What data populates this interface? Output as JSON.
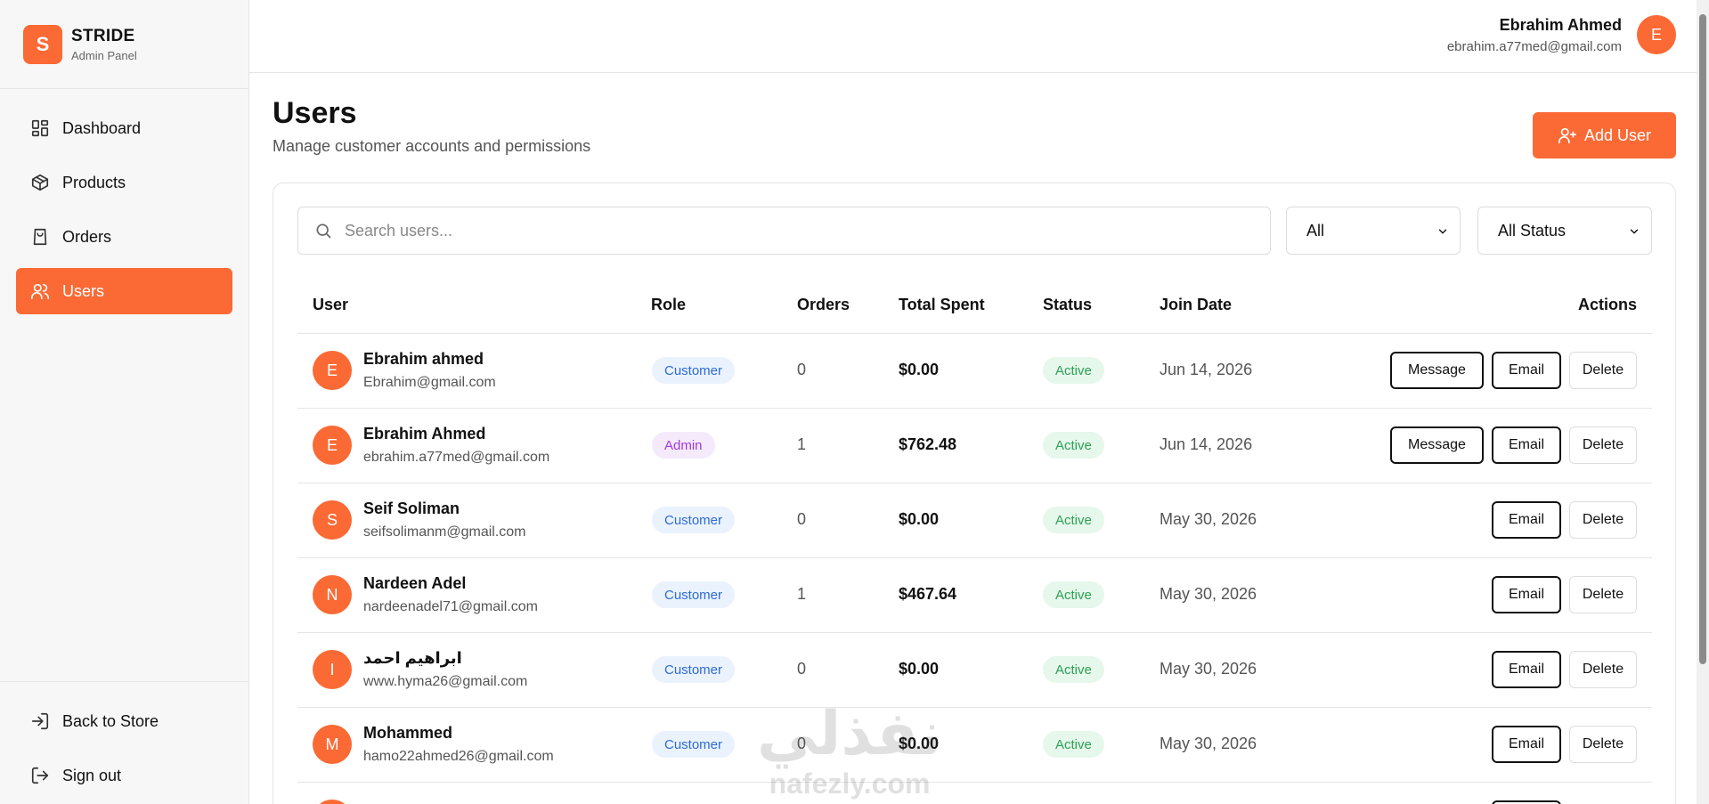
{
  "brand": {
    "logo_letter": "S",
    "name": "STRIDE",
    "subtitle": "Admin Panel"
  },
  "sidebar": {
    "items": [
      {
        "label": "Dashboard",
        "icon": "dashboard-icon",
        "active": false
      },
      {
        "label": "Products",
        "icon": "box-icon",
        "active": false
      },
      {
        "label": "Orders",
        "icon": "shopping-bag-icon",
        "active": false
      },
      {
        "label": "Users",
        "icon": "users-icon",
        "active": true
      }
    ],
    "bottom": [
      {
        "label": "Back to Store",
        "icon": "log-in-icon"
      },
      {
        "label": "Sign out",
        "icon": "log-out-icon"
      }
    ]
  },
  "header": {
    "user_name": "Ebrahim Ahmed",
    "user_email": "ebrahim.a77med@gmail.com",
    "avatar_letter": "E"
  },
  "page": {
    "title": "Users",
    "subtitle": "Manage customer accounts and permissions",
    "add_button": "Add User"
  },
  "filters": {
    "search_placeholder": "Search users...",
    "role_selected": "All",
    "status_selected": "All Status"
  },
  "table": {
    "headers": {
      "user": "User",
      "role": "Role",
      "orders": "Orders",
      "total_spent": "Total Spent",
      "status": "Status",
      "join_date": "Join Date",
      "actions": "Actions"
    },
    "action_labels": {
      "message": "Message",
      "email": "Email",
      "delete": "Delete"
    },
    "rows": [
      {
        "initial": "E",
        "name": "Ebrahim ahmed",
        "email": "Ebrahim@gmail.com",
        "role": "Customer",
        "orders": "0",
        "total": "$0.00",
        "status": "Active",
        "join": "Jun 14, 2026",
        "has_message": true
      },
      {
        "initial": "E",
        "name": "Ebrahim Ahmed",
        "email": "ebrahim.a77med@gmail.com",
        "role": "Admin",
        "orders": "1",
        "total": "$762.48",
        "status": "Active",
        "join": "Jun 14, 2026",
        "has_message": true
      },
      {
        "initial": "S",
        "name": "Seif Soliman",
        "email": "seifsolimanm@gmail.com",
        "role": "Customer",
        "orders": "0",
        "total": "$0.00",
        "status": "Active",
        "join": "May 30, 2026",
        "has_message": false
      },
      {
        "initial": "N",
        "name": "Nardeen Adel",
        "email": "nardeenadel71@gmail.com",
        "role": "Customer",
        "orders": "1",
        "total": "$467.64",
        "status": "Active",
        "join": "May 30, 2026",
        "has_message": false
      },
      {
        "initial": "I",
        "name": "ابراهيم احمد",
        "email": "www.hyma26@gmail.com",
        "role": "Customer",
        "orders": "0",
        "total": "$0.00",
        "status": "Active",
        "join": "May 30, 2026",
        "has_message": false
      },
      {
        "initial": "M",
        "name": "Mohammed",
        "email": "hamo22ahmed26@gmail.com",
        "role": "Customer",
        "orders": "0",
        "total": "$0.00",
        "status": "Active",
        "join": "May 30, 2026",
        "has_message": false
      }
    ]
  },
  "watermark": {
    "arabic": "نفذلي",
    "latin": "nafezly.com"
  },
  "colors": {
    "accent": "#fb6a35",
    "customer_badge": "#2e6bd4",
    "admin_badge": "#a13ad6",
    "active_badge": "#2ea055"
  }
}
